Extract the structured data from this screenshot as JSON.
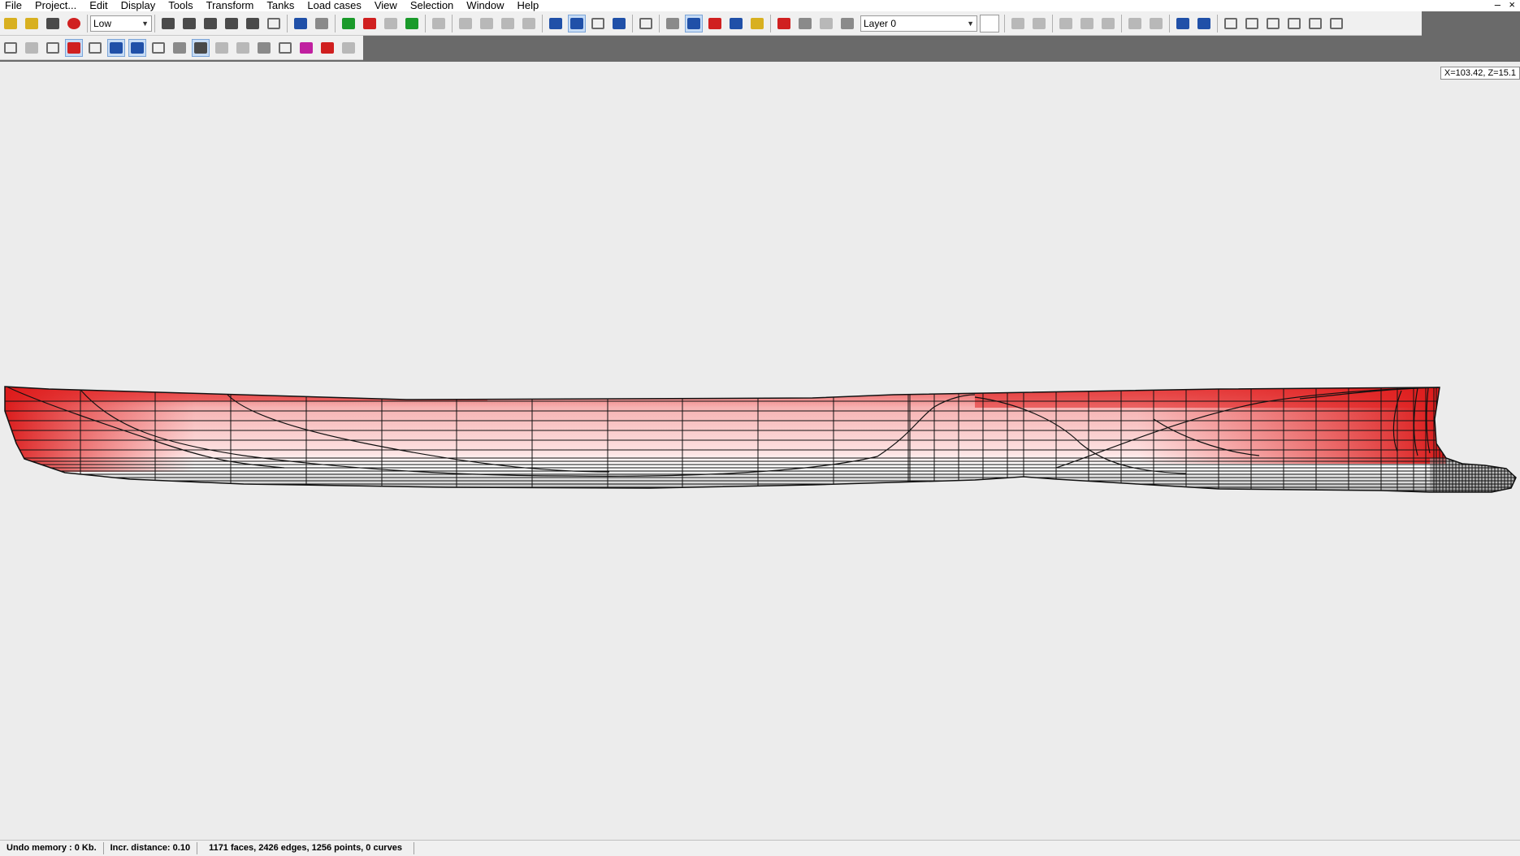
{
  "menu": [
    "File",
    "Project...",
    "Edit",
    "Display",
    "Tools",
    "Transform",
    "Tanks",
    "Load cases",
    "View",
    "Selection",
    "Window",
    "Help"
  ],
  "window_controls": {
    "minimize": "–",
    "close": "×"
  },
  "toolbar": {
    "precision_select": {
      "value": "Low"
    },
    "layer_select": {
      "value": "Layer 0"
    }
  },
  "coordinates": "X=103.42,  Z=15.1",
  "status": {
    "undo_memory": "Undo memory : 0 Kb.",
    "increment": "Incr. distance: 0.10",
    "model_info": "1171 faces, 2426 edges, 1256 points, 0 curves"
  },
  "colors": {
    "viewport_bg": "#ececec",
    "hull_top": "#e81818",
    "hull_mid": "#f9c4c4",
    "hull_bottom": "#b4b4b4",
    "toolbar_bg": "#f0f0f0"
  }
}
